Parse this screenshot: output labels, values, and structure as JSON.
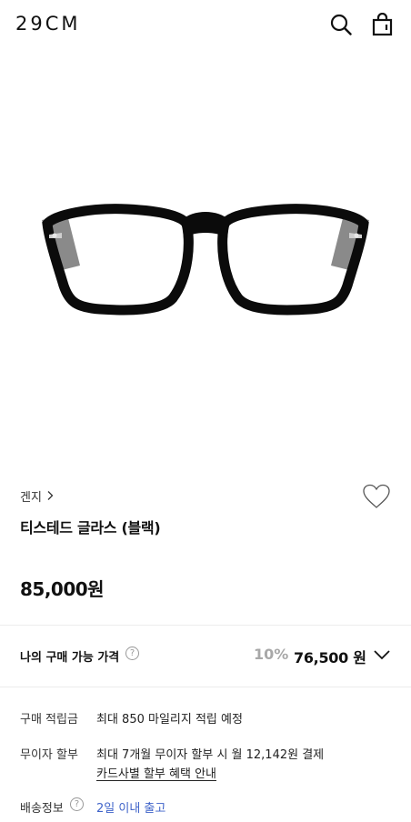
{
  "header": {
    "logo": "29CM",
    "search_icon": "search-icon",
    "bag_icon": "shopping-bag-icon"
  },
  "product": {
    "image_description_icon": "glasses-image",
    "brand": "겐지",
    "name": "티스테드 글라스 (블랙)",
    "price": "85,000원",
    "wish_icon": "heart-outline-icon"
  },
  "my_price": {
    "label": "나의 구매 가능 가격",
    "help": "?",
    "discount": "10%",
    "final_price": "76,500 원"
  },
  "info": {
    "points_label": "구매 적립금",
    "points_value": "최대 850 마일리지 적립 예정",
    "installment_label": "무이자 할부",
    "installment_value": "최대 7개월 무이자 할부 시 월 12,142원 결제",
    "installment_link": "카드사별 할부 혜택 안내",
    "shipping_label": "배송정보",
    "shipping_help": "?",
    "shipping_value": "2일 이내 출고"
  },
  "colors": {
    "accent_blue": "#3f63c9",
    "discount_gray": "#a8a8a8"
  }
}
